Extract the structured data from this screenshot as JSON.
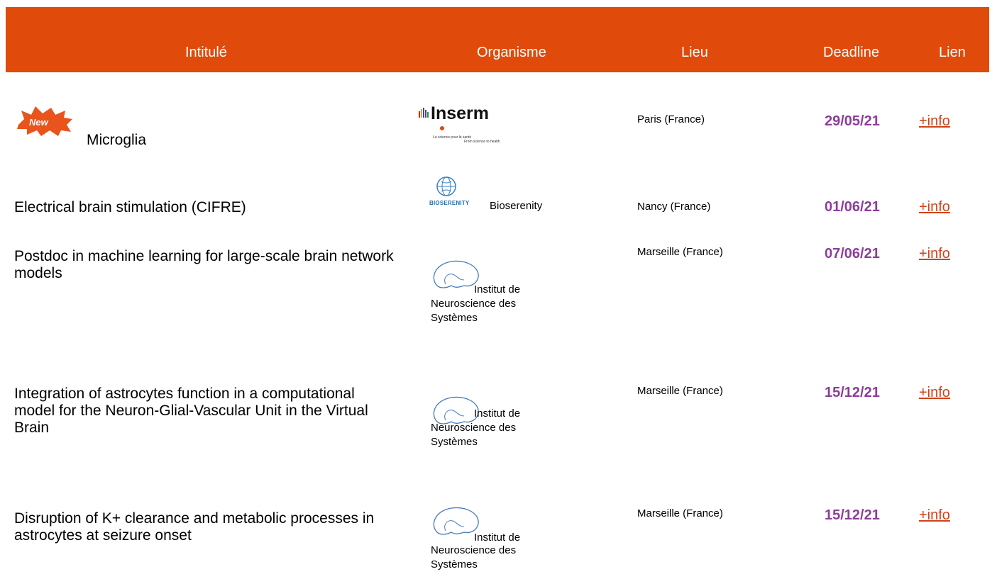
{
  "colors": {
    "header_bg": "#e04a0a",
    "date": "#8e3c9c",
    "link": "#d0421a",
    "badge": "#e8541c"
  },
  "header": {
    "title": "Intitulé",
    "org": "Organisme",
    "lieu": "Lieu",
    "deadline": "Deadline",
    "lien": "Lien"
  },
  "rows": [
    {
      "badge": "New",
      "title": "Microglia",
      "logo": "Inserm",
      "logo_sub1": "La science pour la santé",
      "logo_sub2": "From science to health",
      "lieu": "Paris (France)",
      "deadline": "29/05/21",
      "link": "+info"
    },
    {
      "title": "Electrical brain stimulation (CIFRE)",
      "logo": "BIOSERENITY",
      "org": "Bioserenity",
      "lieu": "Nancy (France)",
      "deadline": "01/06/21",
      "link": "+info"
    },
    {
      "title": "Postdoc in machine learning for large-scale brain network models",
      "org": "Institut de Neuroscience des Systèmes",
      "lieu": "Marseille (France)",
      "deadline": "07/06/21",
      "link": "+info"
    },
    {
      "title": "Integration of astrocytes function in a computational model for the Neuron-Glial-Vascular Unit in the Virtual Brain",
      "org": "Institut de Neuroscience des Systèmes",
      "lieu": "Marseille (France)",
      "deadline": "15/12/21",
      "link": "+info"
    },
    {
      "title": "Disruption of K+ clearance and metabolic processes in astrocytes at seizure onset",
      "org": "Institut de Neuroscience des Systèmes",
      "lieu": "Marseille (France)",
      "deadline": "15/12/21",
      "link": "+info"
    }
  ]
}
